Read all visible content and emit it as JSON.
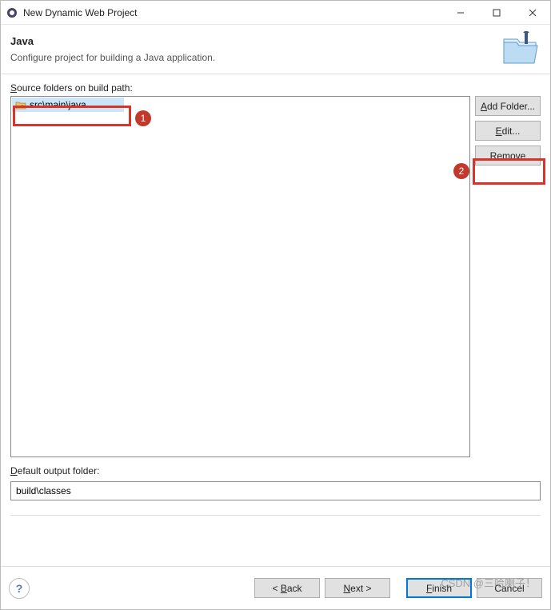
{
  "window": {
    "title": "New Dynamic Web Project",
    "minimize": "—",
    "maximize": "☐",
    "close": "✕"
  },
  "header": {
    "title": "Java",
    "subtitle": "Configure project for building a Java application."
  },
  "main": {
    "source_folders_label": "Source folders on build path:",
    "source_folder_item": "src\\main\\java",
    "add_folder_label": "Add Folder...",
    "edit_label": "Edit...",
    "remove_label": "Remove",
    "default_output_label": "Default output folder:",
    "default_output_value": "build\\classes"
  },
  "footer": {
    "help": "?",
    "back": "< Back",
    "next": "Next >",
    "finish": "Finish",
    "cancel": "Cancel"
  },
  "annotations": {
    "dot1": "1",
    "dot2": "2"
  },
  "watermark": "CSDN @三哈喇子！"
}
